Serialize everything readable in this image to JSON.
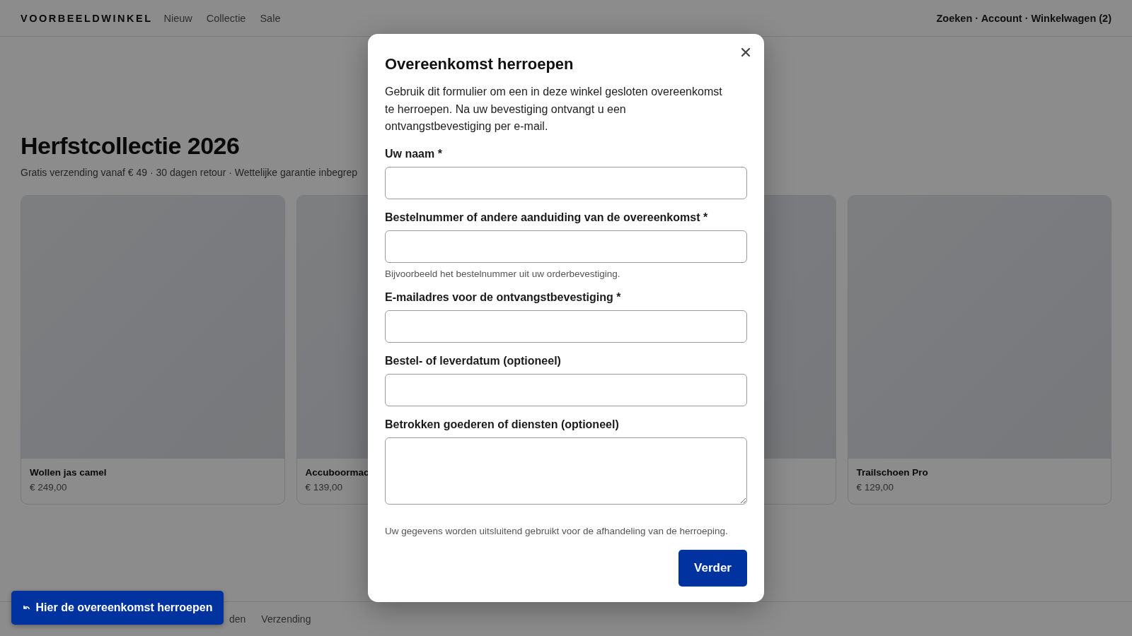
{
  "header": {
    "logo": "VOORBEELDWINKEL",
    "nav": [
      "Nieuw",
      "Collectie",
      "Sale"
    ],
    "account_links": "Zoeken · Account · Winkelwagen (2)"
  },
  "hero": {
    "title": "Herfstcollectie 2026",
    "subtitle": "Gratis verzending vanaf € 49 · 30 dagen retour · Wettelijke garantie inbegrep"
  },
  "products": [
    {
      "kind": "product",
      "name": "Wollen jas camel",
      "price": "€ 249,00"
    },
    {
      "kind": "product",
      "name": "Accuboormac",
      "price": "€ 139,00"
    },
    {
      "kind": "covered"
    },
    {
      "kind": "product",
      "name": "Trailschoen Pro",
      "price": "€ 129,00"
    }
  ],
  "footer": {
    "links": [
      "den",
      "Verzending"
    ]
  },
  "floating_button": {
    "label": "Hier de overeenkomst herroepen"
  },
  "dialog": {
    "title": "Overeenkomst herroepen",
    "intro": "Gebruik dit formulier om een in deze winkel gesloten overeenkomst te herroepen. Na uw bevestiging ontvangt u een ontvangstbevestiging per e-mail.",
    "fields": [
      {
        "kind": "input",
        "label": "Uw naam *"
      },
      {
        "kind": "input",
        "label": "Bestelnummer of andere aanduiding van de overeenkomst *",
        "hint": "Bijvoorbeeld het bestelnummer uit uw orderbevestiging."
      },
      {
        "kind": "input",
        "label": "E-mailadres voor de ontvangstbevestiging *"
      },
      {
        "kind": "input",
        "label": "Bestel- of leverdatum (optioneel)"
      },
      {
        "kind": "textarea",
        "label": "Betrokken goederen of diensten (optioneel)"
      }
    ],
    "privacy_note": "Uw gegevens worden uitsluitend gebruikt voor de afhandeling van de herroeping.",
    "submit": "Verder"
  }
}
